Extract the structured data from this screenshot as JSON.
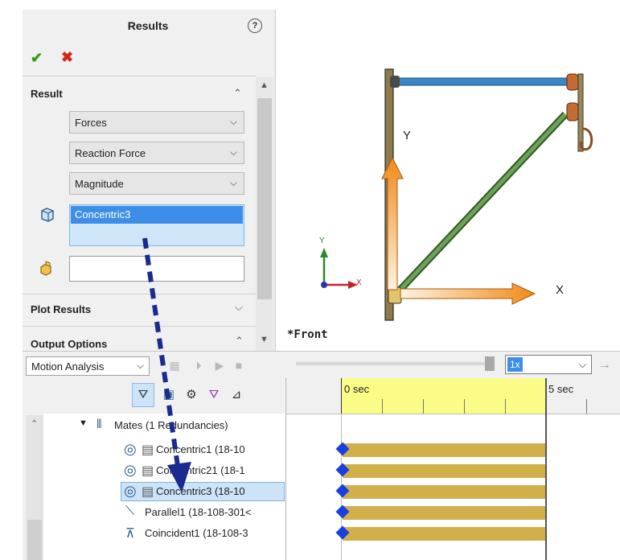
{
  "property_manager": {
    "title": "Results",
    "help_icon": "?",
    "ok_icon": "✔",
    "cancel_icon": "✖",
    "result_section": {
      "label": "Result",
      "dropdowns": [
        "Forces",
        "Reaction Force",
        "Magnitude"
      ],
      "selection_list": [
        "Concentric3"
      ],
      "second_selection": ""
    },
    "plot_results_label": "Plot Results",
    "output_options_label": "Output Options"
  },
  "graphics": {
    "view_label": "*Front",
    "axis_x_label": "X",
    "axis_y_label": "Y",
    "triad_x": "X",
    "triad_y": "Y"
  },
  "motion_manager": {
    "study_type": "Motion Analysis",
    "speed": "1x",
    "tree": {
      "root_label": "Mates (1 Redundancies)",
      "items": [
        {
          "label": "Concentric1 (18-10",
          "icon": "concentric-mate-icon",
          "selected": false
        },
        {
          "label": "Concentric21 (18-1",
          "icon": "concentric-mate-icon",
          "selected": false
        },
        {
          "label": "Concentric3 (18-10",
          "icon": "concentric-mate-icon",
          "selected": true
        },
        {
          "label": "Parallel1 (18-108-301<",
          "icon": "parallel-mate-icon",
          "selected": false
        },
        {
          "label": "Coincident1 (18-108-3",
          "icon": "coincident-mate-icon",
          "selected": false
        }
      ]
    },
    "timeline": {
      "start_label": "0 sec",
      "end_label": "5 sec"
    }
  },
  "colors": {
    "accent_blue": "#3d8ee8",
    "timeline_bar": "#d1b04c",
    "time_range_yellow": "#fbfb88",
    "key_diamond": "#1a3fe0",
    "force_arrow": "#f39a2a",
    "annotation_arrow": "#1a2a8f"
  }
}
